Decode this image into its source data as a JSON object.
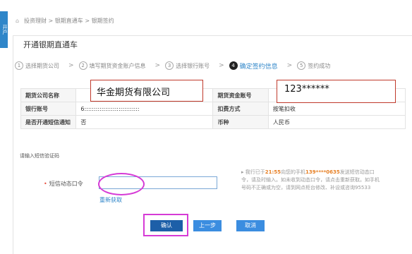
{
  "side_tab": {
    "label": "开户"
  },
  "breadcrumb": {
    "text": "投资理财 > 银期直通车 > 银期签约"
  },
  "panel": {
    "title": "开通银期直通车"
  },
  "steps": [
    {
      "num": "1",
      "label": "选择期货公司"
    },
    {
      "num": "2",
      "label": "填写期货资金账户信息"
    },
    {
      "num": "3",
      "label": "选择银行账号"
    },
    {
      "num": "4",
      "label": "确定签约信息"
    },
    {
      "num": "5",
      "label": "签约成功"
    }
  ],
  "separators": {
    "chevron": ">"
  },
  "info": {
    "row1": {
      "l1": "期货公司名称",
      "v1": "华金期货有限公司",
      "l2": "期货资金账号",
      "v2": "123******"
    },
    "row2": {
      "l1": "银行账号",
      "v1": "6:::::::::::::::::::::::::::::",
      "l2": "扣费方式",
      "v2": "按笔扣收"
    },
    "row3": {
      "l1": "是否开通短信通知",
      "v1": "否",
      "l2": "币种",
      "v2": "人民币"
    }
  },
  "sms": {
    "section_title": "请输入短信验证码",
    "required_mark": "•",
    "field_label": "短信动态口令",
    "field_value": "",
    "resend_label": "重新获取"
  },
  "hint": {
    "arrow": "▸",
    "part1": "我行已于",
    "time": "21:55",
    "part2": "向您的手机",
    "phone": "139****0635",
    "part3": "发送短信动态口令，请及时输入。如未收到动态口令，请点击重新获取。如手机号码不正确或为空，请到网点柜台修改、补设或咨询95533"
  },
  "buttons": {
    "confirm": "确认",
    "prev": "上一步",
    "cancel": "取消"
  }
}
